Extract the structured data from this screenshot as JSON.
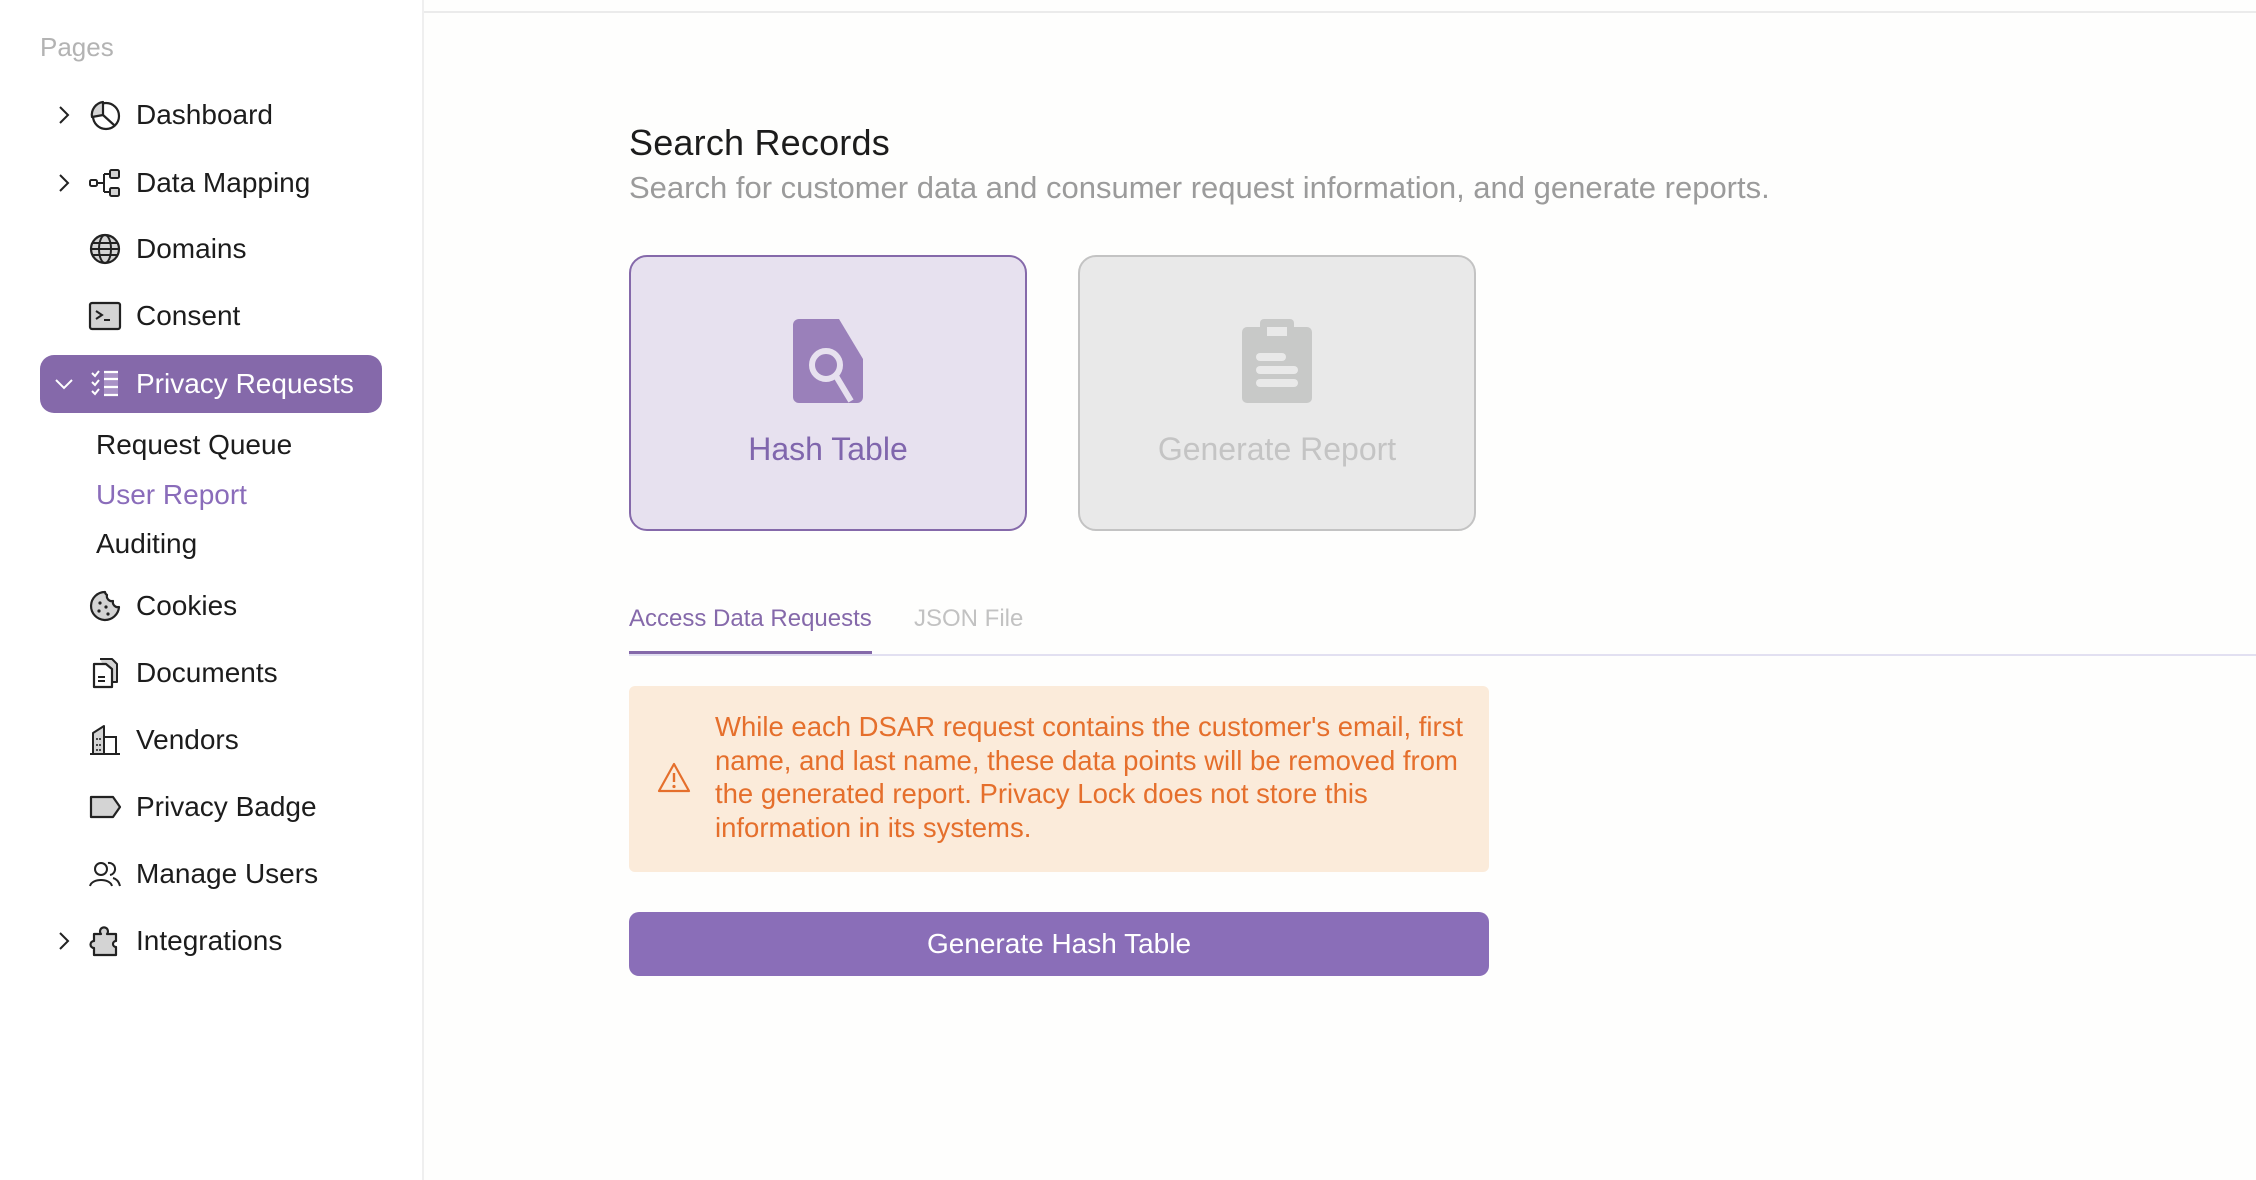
{
  "sidebar": {
    "section_label": "Pages",
    "items": [
      {
        "label": "Dashboard",
        "icon": "pie-chart-icon",
        "expandable": true
      },
      {
        "label": "Data Mapping",
        "icon": "hierarchy-icon",
        "expandable": true
      },
      {
        "label": "Domains",
        "icon": "globe-icon",
        "expandable": false
      },
      {
        "label": "Consent",
        "icon": "terminal-window-icon",
        "expandable": false
      },
      {
        "label": "Privacy Requests",
        "icon": "checklist-icon",
        "expandable": true,
        "expanded": true,
        "active": true,
        "children": [
          {
            "label": "Request Queue"
          },
          {
            "label": "User Report",
            "current": true
          },
          {
            "label": "Auditing"
          }
        ]
      },
      {
        "label": "Cookies",
        "icon": "cookie-icon",
        "expandable": false
      },
      {
        "label": "Documents",
        "icon": "documents-icon",
        "expandable": false
      },
      {
        "label": "Vendors",
        "icon": "buildings-icon",
        "expandable": false
      },
      {
        "label": "Privacy Badge",
        "icon": "tag-icon",
        "expandable": false
      },
      {
        "label": "Manage Users",
        "icon": "users-icon",
        "expandable": false
      },
      {
        "label": "Integrations",
        "icon": "puzzle-piece-icon",
        "expandable": true
      }
    ]
  },
  "main": {
    "title": "Search Records",
    "subtitle": "Search for customer data and consumer request information, and generate reports.",
    "cards": [
      {
        "label": "Hash Table",
        "icon": "file-search-icon",
        "state": "selected"
      },
      {
        "label": "Generate Report",
        "icon": "clipboard-icon",
        "state": "disabled"
      }
    ],
    "tabs": [
      {
        "label": "Access Data Requests",
        "active": true
      },
      {
        "label": "JSON File",
        "active": false
      }
    ],
    "alert": {
      "icon": "warning-icon",
      "text": "While each DSAR request contains the customer's email, first name, and last name, these data points will be removed from the generated report. Privacy Lock does not store this information in its systems."
    },
    "primary_button": "Generate Hash Table"
  },
  "colors": {
    "accent": "#8569aa",
    "accent_light": "#e7e1ef",
    "warning_text": "#e56f2c",
    "warning_bg": "#fbebda",
    "disabled_bg": "#e9e9e9"
  }
}
